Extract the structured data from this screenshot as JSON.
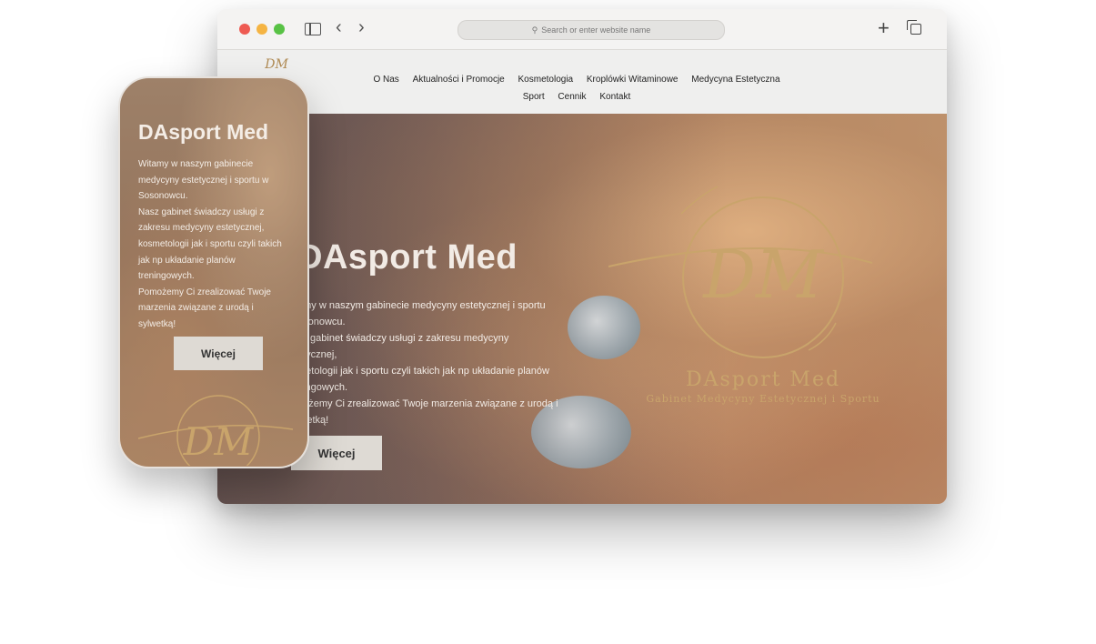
{
  "browser": {
    "address_placeholder": "Search or enter website name"
  },
  "site": {
    "logo_initials": "DM",
    "nav": [
      "O Nas",
      "Aktualności i Promocje",
      "Kosmetologia",
      "Kroplówki Witaminowe",
      "Medycyna Estetyczna",
      "Sport",
      "Cennik",
      "Kontakt"
    ]
  },
  "hero": {
    "title": "DAsport Med",
    "lines": [
      "amy w naszym gabinecie medycyny estetycznej i sportu",
      "osonowcu.",
      "sz gabinet świadczy usługi z zakresu medycyny",
      "etycznej,",
      "metologii jak i sportu czyli takich jak np układanie planów",
      "ningowych.",
      "nożemy Ci zrealizować Twoje marzenia związane z urodą i",
      "lwetką!"
    ],
    "button": "Więcej",
    "logo_brand": "DAsport Med",
    "logo_tagline": "Gabinet Medycyny Estetycznej i Sportu",
    "logo_initials": "DM"
  },
  "phone": {
    "title": "DAsport Med",
    "lines": [
      "Witamy w naszym gabinecie",
      "medycyny estetycznej i sportu w",
      "Sosonowcu.",
      "Nasz gabinet świadczy usługi z",
      "zakresu medycyny estetycznej,",
      "kosmetologii jak i sportu czyli takich",
      "jak np układanie planów",
      "treningowych.",
      "Pomożemy Ci zrealizować Twoje",
      "marzenia związane z urodą i",
      "sylwetką!"
    ],
    "button": "Więcej",
    "logo_initials": "DM"
  },
  "colors": {
    "gold": "#c9a46b",
    "button_bg": "#dedad4"
  }
}
